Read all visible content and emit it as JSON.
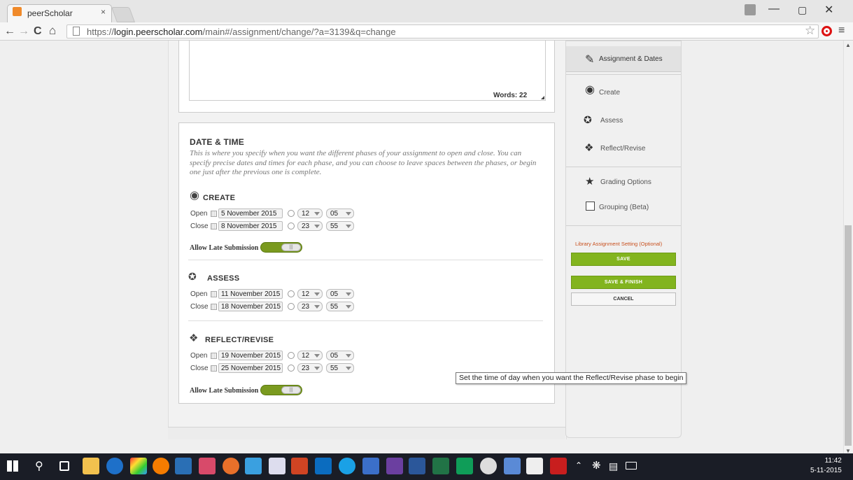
{
  "browser": {
    "tab_title": "peerScholar",
    "tab_close": "×",
    "url_prefix": "https://",
    "url_host": "login.peerscholar.com",
    "url_path": "/main#/assignment/change/?a=3139&q=change",
    "nav_back": "←",
    "nav_forward": "→",
    "nav_reload": "C",
    "nav_home": "⌂",
    "star": "☆",
    "menu": "≡",
    "win_min": "—",
    "win_max": "▢",
    "win_close": "✕"
  },
  "editor": {
    "words": "Words: 22"
  },
  "date_time": {
    "title": "DATE & TIME",
    "description": "This is where you specify when you want the different phases of your assignment to open and close. You can specify precise dates and times for each phase, and you can choose to leave spaces between the phases, or begin one just after the previous one is complete.",
    "open_label": "Open",
    "close_label": "Close",
    "late_label": "Allow Late Submission",
    "phases": [
      {
        "name": "CREATE",
        "icon": "bulb-icon",
        "open_date": "5 November 2015",
        "open_hour": "12",
        "open_min": "05",
        "close_date": "8 November 2015",
        "close_hour": "23",
        "close_min": "55"
      },
      {
        "name": "ASSESS",
        "icon": "hands-icon",
        "open_date": "11 November 2015",
        "open_hour": "12",
        "open_min": "05",
        "close_date": "18 November 2015",
        "close_hour": "23",
        "close_min": "55"
      },
      {
        "name": "REFLECT/REVISE",
        "icon": "reflect-icon",
        "open_date": "19 November 2015",
        "open_hour": "12",
        "open_min": "05",
        "close_date": "25 November 2015",
        "close_hour": "23",
        "close_min": "55"
      }
    ]
  },
  "sidebar": {
    "items": [
      {
        "label": "Assignment & Dates",
        "icon": "edit-icon"
      },
      {
        "label": "Create",
        "icon": "bulb-icon"
      },
      {
        "label": "Assess",
        "icon": "hands-icon"
      },
      {
        "label": "Reflect/Revise",
        "icon": "reflect-icon"
      },
      {
        "label": "Grading Options",
        "icon": "star-icon"
      },
      {
        "label": "Grouping (Beta)",
        "icon": "grouping-icon"
      }
    ],
    "library_link": "Library Assignment Setting (Optional)",
    "save": "SAVE",
    "save_finish": "SAVE & FINISH",
    "cancel": "CANCEL"
  },
  "tooltip": "Set the time of day when you want the Reflect/Revise phase to begin",
  "taskbar": {
    "time": "11:42",
    "date": "5-11-2015"
  },
  "colors": {
    "accent_green": "#82b41e",
    "toggle_green": "#7a9a1f",
    "link_orange": "#c8501e",
    "taskbar": "#1a1d26"
  }
}
